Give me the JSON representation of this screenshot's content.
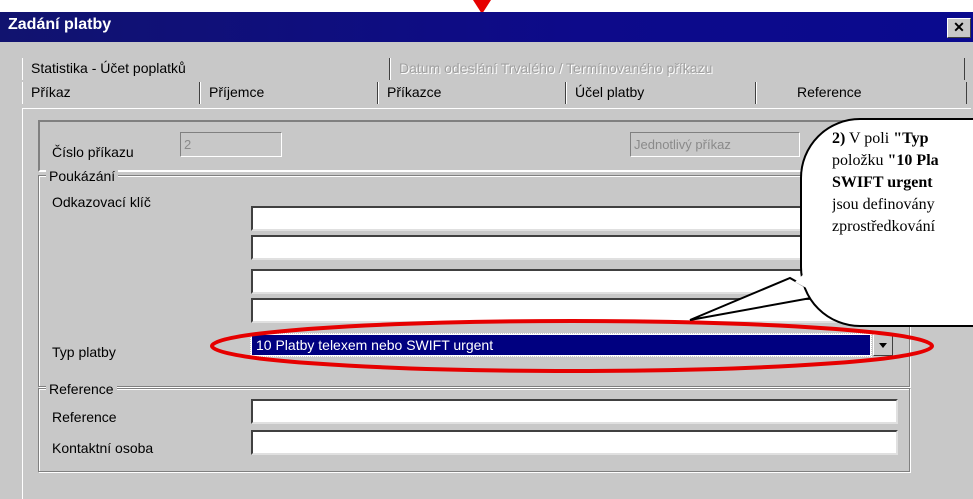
{
  "window": {
    "title": "Zadání platby",
    "close_glyph": "✕"
  },
  "tabs_back": [
    {
      "label": "Statistika - Účet poplatků",
      "disabled": false
    },
    {
      "label": "Datum odeslání Trvalého / Termínovaného příkazu",
      "disabled": true
    }
  ],
  "tabs_front": [
    {
      "label": "Příkaz"
    },
    {
      "label": "Příjemce"
    },
    {
      "label": "Příkazce"
    },
    {
      "label": "Účel platby"
    },
    {
      "label": "Reference",
      "active": true
    }
  ],
  "order": {
    "number_label": "Číslo příkazu",
    "number_value": "2",
    "type_value": "Jednotlivý příkaz"
  },
  "remittance": {
    "group_label": "Poukázání",
    "key_label": "Odkazovací klíč",
    "key_lines": [
      "",
      "",
      "",
      ""
    ],
    "payment_type_label": "Typ platby",
    "payment_type_value": "10 Platby telexem nebo SWIFT urgent"
  },
  "reference": {
    "group_label": "Reference",
    "reference_label": "Reference",
    "reference_value": "",
    "contact_label": "Kontaktní osoba",
    "contact_value": ""
  },
  "callout": {
    "lines": [
      {
        "bold": "2)",
        "text": " V poli ",
        "tail_bold": "\"Typ"
      },
      {
        "text": "položku ",
        "tail_bold": "\"10 Pla"
      },
      {
        "bold": "SWIFT urgent",
        "text": ""
      },
      {
        "text": "jsou definovány"
      },
      {
        "text": "zprostředkování"
      }
    ]
  },
  "colors": {
    "titlebar": "#0a0a8e",
    "highlight_ring": "#e60000",
    "selection": "#000080"
  }
}
